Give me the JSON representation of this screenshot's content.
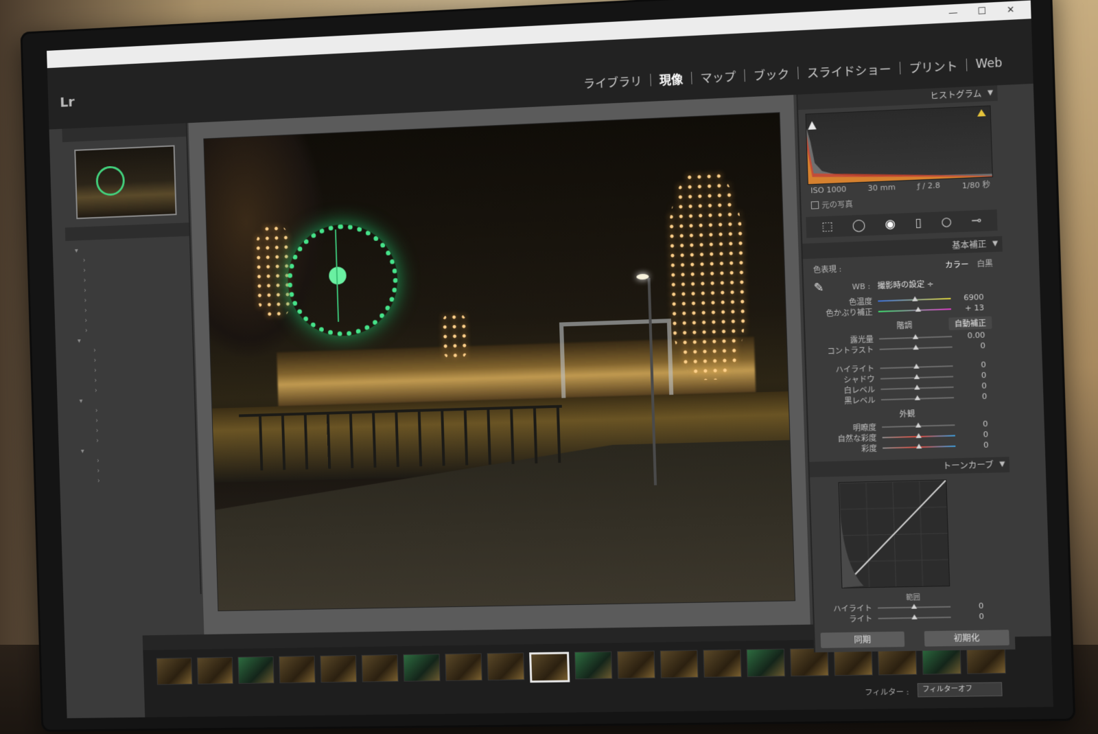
{
  "titlebar": {
    "title": "",
    "minimize": "—",
    "maximize": "☐",
    "close": "✕"
  },
  "app": {
    "logo": "Lr",
    "catalog": ""
  },
  "modules": [
    {
      "label": "ライブラリ"
    },
    {
      "label": "現像",
      "active": true
    },
    {
      "label": "マップ"
    },
    {
      "label": "ブック"
    },
    {
      "label": "スライドショー"
    },
    {
      "label": "プリント"
    },
    {
      "label": "Web"
    }
  ],
  "histogram": {
    "header": "ヒストグラム",
    "iso": "ISO 1000",
    "focal": "30 mm",
    "aperture": "ƒ / 2.8",
    "shutter": "1/80 秒",
    "original_photo": "元の写真"
  },
  "basic": {
    "header": "基本補正",
    "treatment_label": "色表現 :",
    "treatment_color": "カラー",
    "treatment_bw": "白黒",
    "wb_label": "WB :",
    "wb_value": "撮影時の設定 ÷",
    "temp_label": "色温度",
    "temp_value": "6900",
    "tint_label": "色かぶり補正",
    "tint_value": "+ 13",
    "tone_head": "階調",
    "auto_label": "自動補正",
    "exposure_label": "露光量",
    "exposure_value": "0.00",
    "contrast_label": "コントラスト",
    "contrast_value": "0",
    "highlights_label": "ハイライト",
    "highlights_value": "0",
    "shadows_label": "シャドウ",
    "shadows_value": "0",
    "whites_label": "白レベル",
    "whites_value": "0",
    "blacks_label": "黒レベル",
    "blacks_value": "0",
    "presence_head": "外観",
    "clarity_label": "明瞭度",
    "clarity_value": "0",
    "vibrance_label": "自然な彩度",
    "vibrance_value": "0",
    "saturation_label": "彩度",
    "saturation_value": "0"
  },
  "tone_curve": {
    "header": "トーンカーブ",
    "range_label": "範囲",
    "highlights_label": "ハイライト",
    "lights_label": "ライト",
    "highlights_value": "0",
    "lights_value": "0"
  },
  "buttons": {
    "sync": "同期",
    "reset": "初期化"
  },
  "filmstrip": {
    "filter_label": "フィルター :",
    "filter_value": "フィルターオフ",
    "thumb_count": 20,
    "selected_index": 9
  },
  "colors": {
    "accent": "#ffffff",
    "panel_bg": "#3b3b3b",
    "titlebar_bg": "#ececec"
  }
}
